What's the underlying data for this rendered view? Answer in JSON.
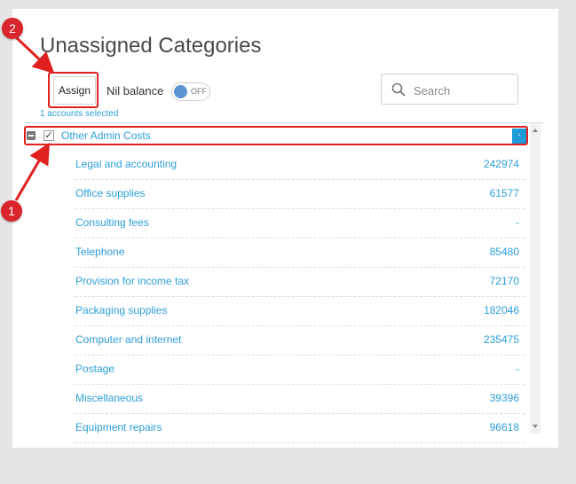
{
  "panel": {
    "title": "Unassigned Categories",
    "assign_label": "Assign",
    "nil_balance_label": "Nil balance",
    "toggle_state": "OFF",
    "search_placeholder": "Search",
    "selected_count": "1 accounts selected"
  },
  "group": {
    "label": "Other Admin Costs",
    "checked": true,
    "toggle_symbol": "-"
  },
  "rows": [
    {
      "name": "Legal and accounting",
      "value": "242974"
    },
    {
      "name": "Office supplies",
      "value": "61577"
    },
    {
      "name": "Consulting fees",
      "value": "-"
    },
    {
      "name": "Telephone",
      "value": "85480"
    },
    {
      "name": "Provision for income tax",
      "value": "72170"
    },
    {
      "name": "Packaging supplies",
      "value": "182046"
    },
    {
      "name": "Computer and internet",
      "value": "235475"
    },
    {
      "name": "Postage",
      "value": "-"
    },
    {
      "name": "Miscellaneous",
      "value": "39396"
    },
    {
      "name": "Equipment repairs",
      "value": "96618"
    }
  ],
  "annotations": {
    "badge_1": "1",
    "badge_2": "2"
  },
  "colors": {
    "accent": "#2d9fd9",
    "highlight": "#e12020",
    "badge": "#d9262c",
    "toggle_knob": "#5b95d1"
  },
  "icons": {
    "search": "search-icon",
    "collapse": "collapse-icon",
    "checkbox": "checkbox-checked-icon"
  }
}
